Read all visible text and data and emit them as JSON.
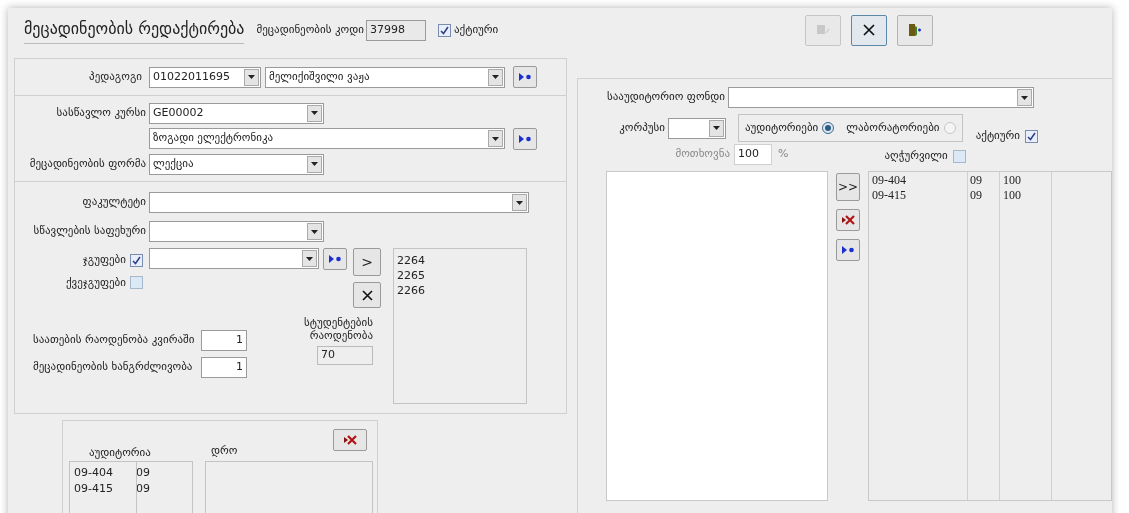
{
  "title": "მეცადინეობის რედაქტირება",
  "code": {
    "label": "მეცადინეობის კოდი",
    "value": "37998"
  },
  "active": {
    "label": "აქტიური",
    "checked": true
  },
  "toolbar": [
    {
      "kind": "save",
      "disabled": true,
      "focused": false
    },
    {
      "kind": "cancel",
      "disabled": false,
      "focused": true
    },
    {
      "kind": "exit",
      "disabled": false,
      "focused": false
    }
  ],
  "teacher": {
    "label": "პედაგოგი",
    "id": "01022011695",
    "name": "მელიქიშვილი ვაჟა"
  },
  "course": {
    "label": "სასწავლო კურსი",
    "code": "GE00002",
    "name": "ზოგადი ელექტრონიკა"
  },
  "form": {
    "label": "მეცადინეობის ფორმა",
    "value": "ლექცია"
  },
  "faculty": {
    "label": "ფაკულტეტი"
  },
  "level": {
    "label": "სწავლების საფეხური"
  },
  "groups": {
    "label": "ჯგუფები",
    "checked": true
  },
  "subgroups": {
    "label": "ქვეჯგუფები",
    "checked": false
  },
  "add_button": ">",
  "group_list": [
    "2264",
    "2265",
    "2266"
  ],
  "hours": {
    "label": "საათების რაოდენობა კვირაში",
    "value": "1"
  },
  "duration": {
    "label": "მეცადინეობის ხანგრძლივობა",
    "value": "1"
  },
  "students": {
    "label": "სტუდენტების რაოდენობა",
    "value": "70"
  },
  "schedule": {
    "room_header": "აუდიტორია",
    "time_header": "დრო",
    "rooms": [
      [
        "09-404",
        "09"
      ],
      [
        "09-415",
        "09"
      ]
    ]
  },
  "fund": {
    "label": "სააუდიტორიო ფონდი"
  },
  "building": {
    "label": "კორპუსი"
  },
  "room_types": [
    {
      "label": "აუდიტორიები",
      "selected": true
    },
    {
      "label": "ლაბორატორიები",
      "selected": false
    }
  ],
  "active2": {
    "label": "აქტიური",
    "checked": true
  },
  "demand": {
    "label": "მოთხოვნა",
    "value": "100",
    "unit": "%"
  },
  "equipped": {
    "label": "აღჭურვილი",
    "checked": false
  },
  "move_all": ">>",
  "assigned": [
    [
      "09-404",
      "09",
      "100"
    ],
    [
      "09-415",
      "09",
      "100"
    ]
  ]
}
